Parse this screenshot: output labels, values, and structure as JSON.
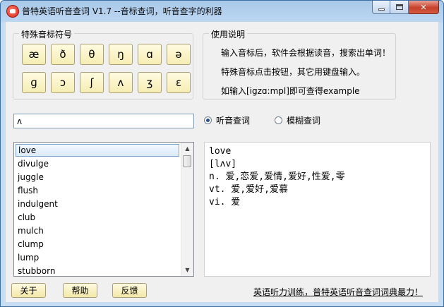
{
  "window": {
    "title": "普特英语听音查词 V1.7 --音标查词，听音查字的利器"
  },
  "symbols_group": {
    "title": "特殊音标符号",
    "row1": [
      "æ",
      "ð",
      "θ",
      "ŋ",
      "ɑ",
      "ə"
    ],
    "row2": [
      "ɡ",
      "ɔ",
      "ʃ",
      "ʌ",
      "ʒ",
      "ɛ"
    ]
  },
  "help_group": {
    "title": "使用说明",
    "lines": [
      "输入音标后，软件会根据读音，搜索出单词！",
      "特殊音标点击按钮，其它用键盘输入。",
      "如输入[igzɑ:mpl]即可查得example"
    ]
  },
  "search": {
    "value": "ʌ"
  },
  "modes": {
    "listen": "听音查词",
    "fuzzy": "模糊查词",
    "selected": "listen"
  },
  "word_list": [
    "love",
    "divulge",
    "juggle",
    "flush",
    "indulgent",
    "club",
    "mulch",
    "clump",
    "lump",
    "stubborn"
  ],
  "selected_word": "love",
  "detail": {
    "lines": [
      "love",
      "[lʌv]",
      "n. 爱,恋爱,爱情,爱好,性爱,零",
      "vt. 爱,爱好,爱慕",
      "vi. 爱"
    ]
  },
  "buttons": {
    "about": "关于",
    "help": "帮助",
    "feedback": "反馈"
  },
  "footer_link": "英语听力训练，普特英语听音查词词典最力！"
}
